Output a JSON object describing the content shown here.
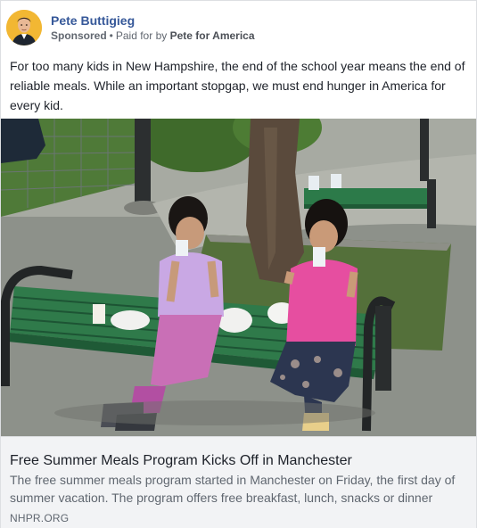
{
  "post": {
    "author": "Pete Buttigieg",
    "sponsored_label": "Sponsored",
    "paid_prefix": "Paid for by",
    "payer": "Pete for America",
    "text": "For too many kids in New Hampshire, the end of the school year means the end of reliable meals. While an important stopgap, we must end hunger in America for every kid."
  },
  "link": {
    "title": "Free Summer Meals Program Kicks Off in Manchester",
    "description": "The free summer meals program started in Manchester on Friday, the first day of summer vacation. The program offers free breakfast, lunch, snacks or dinner",
    "domain": "NHPR.ORG"
  },
  "colors": {
    "author_link": "#365899",
    "meta_text": "#616770",
    "link_bg": "#f2f3f5",
    "bench_green": "#2f7a4a"
  },
  "icons": {
    "avatar": "profile-photo",
    "dot": "•"
  }
}
